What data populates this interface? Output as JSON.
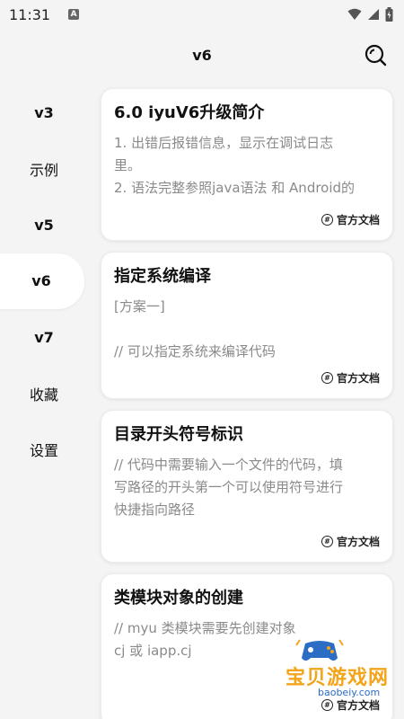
{
  "status_bar": {
    "time": "11:31",
    "notification_icon": "a-notification-icon",
    "wifi_icon": "wifi-icon",
    "signal_icon": "signal-icon",
    "battery_icon": "battery-icon"
  },
  "header": {
    "title": "v6",
    "search_icon": "search-icon"
  },
  "sidebar": {
    "items": [
      {
        "label": "v3",
        "active": false
      },
      {
        "label": "示例",
        "active": false
      },
      {
        "label": "v5",
        "active": false
      },
      {
        "label": "v6",
        "active": true
      },
      {
        "label": "v7",
        "active": false
      },
      {
        "label": "收藏",
        "active": false
      },
      {
        "label": "设置",
        "active": false
      }
    ]
  },
  "cards": [
    {
      "title": "6.0 iyuV6升级简介",
      "lines": [
        "1. 出错后报错信息，显示在调试日志",
        "里。",
        "2. 语法完整参照java语法 和 Android的"
      ],
      "footer": "官方文档"
    },
    {
      "title": "指定系统编译",
      "lines": [
        "[方案一]",
        "",
        "// 可以指定系统来编译代码"
      ],
      "footer": "官方文档"
    },
    {
      "title": "目录开头符号标识",
      "lines": [
        "// 代码中需要输入一个文件的代码，填",
        "写路径的开头第一个可以使用符号进行",
        "快捷指向路径"
      ],
      "footer": "官方文档"
    },
    {
      "title": "类模块对象的创建",
      "lines": [
        "// myu 类模块需要先创建对象",
        "cj 或  iapp.cj",
        ""
      ],
      "footer": "官方文档"
    }
  ],
  "watermark": {
    "text": "宝贝游戏网",
    "url": "baobeiy.com"
  },
  "colors": {
    "background": "#f4f4f4",
    "card": "#ffffff",
    "body_text": "#8a8a8a",
    "watermark_orange": "#f3a41a",
    "watermark_blue": "#2b6cc4"
  }
}
